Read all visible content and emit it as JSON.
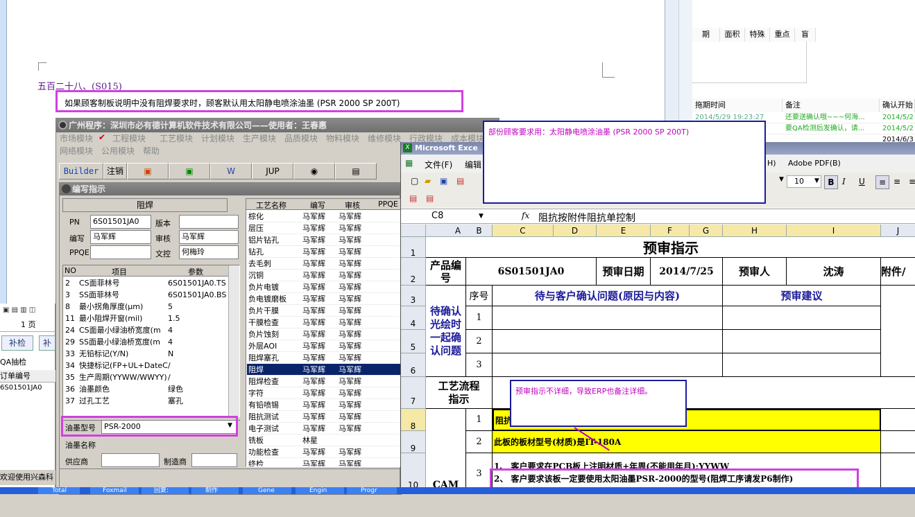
{
  "word": {
    "heading": "五百二十八、(S015)",
    "paragraph": "如果顾客制板说明中没有阻焊要求时，顾客默认用太阳静电喷涂油墨 (PSR 2000 SP 200T)",
    "page_label": "1 页"
  },
  "right_panel": {
    "top_headers": [
      "期",
      "面积",
      "特殊",
      "重点",
      "盲"
    ],
    "headers": [
      "拖期时间",
      "备注",
      "确认开始"
    ],
    "rows": [
      {
        "time": "2014/5/29 19:23:27",
        "note": "还要送确认哦~~~何海...",
        "start": "2014/5/2"
      },
      {
        "time": "",
        "note": "要QA检测后发确认，请...",
        "start": "2014/5/2"
      },
      {
        "time": "",
        "note": "",
        "start": "2014/6/3"
      }
    ]
  },
  "left_strip": {
    "button1": "补检",
    "button2": "补",
    "label": "QA抽检",
    "col_header": "订单编号",
    "row_value": "6S01501JA0",
    "welcome": "欢迎使用兴森科"
  },
  "main_window": {
    "title": "广州程序：深圳市必有德计算机软件技术有限公司——使用者：王春惠",
    "menu_row1": [
      "市场模块",
      "工程模块",
      "工艺模块",
      "计划模块",
      "生产模块",
      "品质模块",
      "物料模块",
      "维修模块",
      "行政模块",
      "成本模块"
    ],
    "menu_row2": [
      "网络模块",
      "公用模块",
      "帮助"
    ],
    "toolbar": [
      "Builder",
      "注销",
      "",
      "",
      "",
      "JUP",
      "",
      ""
    ],
    "sub_title": "编写指示",
    "section": "阻焊",
    "pn_label": "PN",
    "pn_value": "6S01501JA0",
    "version_label": "版本",
    "author_label": "编写",
    "author_value": "马军辉",
    "review_label": "审核",
    "review_value": "马军辉",
    "ppqe_label": "PPQE",
    "doc_label": "文控",
    "doc_value": "何梅玲",
    "param_headers": [
      "NO",
      "项目",
      "参数"
    ],
    "params": [
      {
        "no": "2",
        "item": "CS面菲林号",
        "val": "6S01501JA0.TS"
      },
      {
        "no": "3",
        "item": "SS面菲林号",
        "val": "6S01501JA0.BS"
      },
      {
        "no": "8",
        "item": "最小拐角厚度(μm)",
        "val": "5"
      },
      {
        "no": "11",
        "item": "最小阻焊开窗(mil)",
        "val": "1.5"
      },
      {
        "no": "24",
        "item": "CS面最小绿油桥宽度(m",
        "val": "4"
      },
      {
        "no": "29",
        "item": "SS面最小绿油桥宽度(m",
        "val": "4"
      },
      {
        "no": "33",
        "item": "无铅标记(Y/N)",
        "val": "N"
      },
      {
        "no": "34",
        "item": "快捷标记(FP+UL+DateCo",
        "val": "/"
      },
      {
        "no": "35",
        "item": "生产周期(YYWW/WWYY)",
        "val": "/"
      },
      {
        "no": "36",
        "item": "油墨颜色",
        "val": "绿色"
      },
      {
        "no": "37",
        "item": "过孔工艺",
        "val": "塞孔"
      }
    ],
    "ink_type_label": "油墨型号",
    "ink_type_value": "PSR-2000",
    "ink_name_label": "油墨名称",
    "supplier_label": "供应商",
    "maker_label": "制造商",
    "proc_headers": [
      "工艺名称",
      "编写",
      "审核",
      "PPQE"
    ],
    "procs": [
      {
        "n": "棕化",
        "a": "马军辉",
        "b": "马军辉"
      },
      {
        "n": "层压",
        "a": "马军辉",
        "b": "马军辉"
      },
      {
        "n": "铝片钻孔",
        "a": "马军辉",
        "b": "马军辉"
      },
      {
        "n": "钻孔",
        "a": "马军辉",
        "b": "马军辉"
      },
      {
        "n": "去毛刺",
        "a": "马军辉",
        "b": "马军辉"
      },
      {
        "n": "沉铜",
        "a": "马军辉",
        "b": "马军辉"
      },
      {
        "n": "负片电镀",
        "a": "马军辉",
        "b": "马军辉"
      },
      {
        "n": "负电镀磨板",
        "a": "马军辉",
        "b": "马军辉"
      },
      {
        "n": "负片干膜",
        "a": "马军辉",
        "b": "马军辉"
      },
      {
        "n": "干膜检查",
        "a": "马军辉",
        "b": "马军辉"
      },
      {
        "n": "负片蚀刻",
        "a": "马军辉",
        "b": "马军辉"
      },
      {
        "n": "外层AOI",
        "a": "马军辉",
        "b": "马军辉"
      },
      {
        "n": "阻焊塞孔",
        "a": "马军辉",
        "b": "马军辉"
      },
      {
        "n": "阻焊",
        "a": "马军辉",
        "b": "马军辉"
      },
      {
        "n": "阻焊检查",
        "a": "马军辉",
        "b": "马军辉"
      },
      {
        "n": "字符",
        "a": "马军辉",
        "b": "马军辉"
      },
      {
        "n": "有铅喷锡",
        "a": "马军辉",
        "b": "马军辉"
      },
      {
        "n": "阻抗测试",
        "a": "马军辉",
        "b": "马军辉"
      },
      {
        "n": "电子测试",
        "a": "马军辉",
        "b": "马军辉"
      },
      {
        "n": "铣板",
        "a": "林星",
        "b": ""
      },
      {
        "n": "功能检查",
        "a": "马军辉",
        "b": "马军辉"
      },
      {
        "n": "终检",
        "a": "马军辉",
        "b": "马军辉"
      }
    ]
  },
  "excel": {
    "title": "Microsoft Exce",
    "menu": [
      "文件(F)",
      "编辑"
    ],
    "menu_right": [
      "H)",
      "Adobe PDF(B)"
    ],
    "font_size": "10",
    "cell_ref": "C8",
    "formula": "阻抗按附件阻抗单控制",
    "columns": [
      "A",
      "B",
      "C",
      "D",
      "E",
      "F",
      "G",
      "H",
      "I",
      "J"
    ],
    "rows": [
      "1",
      "2",
      "3",
      "4",
      "5",
      "6",
      "7",
      "8",
      "9",
      "10"
    ],
    "sheet_title": "预审指示",
    "product_no_label": "产品编号",
    "product_no": "6S01501JA0",
    "date_label": "预审日期",
    "date": "2014/7/25",
    "reviewer_label": "预审人",
    "reviewer": "沈涛",
    "attach_label": "附件/",
    "seq_label": "序号",
    "issue_header": "待与客户确认问题(原因与内容)",
    "advice_header": "预审建议",
    "confirm_label": "待确认光绘时一起确认问题",
    "seq": [
      "1",
      "2",
      "3"
    ],
    "process_label": "工艺流程指示",
    "cam_label": "CAM",
    "r8_no": "1",
    "r8_text": "阻抗",
    "r9_no": "2",
    "r9_text": "此板的板材型号(材质)是IT-180A",
    "r10_no": "3",
    "r10_line1": "1、 客户要求在PCB板上注明材质+年周(不能用年月);YYWW",
    "r10_line2": "2、 客户要求该板一定要使用太阳油墨PSR-2000的型号(阻焊工序请发P6制作)"
  },
  "callouts": {
    "top": "部份顾客要求用：太阳静电喷涂油墨 (PSR 2000 SP 200T)",
    "mid": "预审指示不详细，导致ERP也备注详细。"
  },
  "taskbar": [
    "Total",
    "Foxmail",
    "回复:",
    "制作",
    "Gene",
    "Engin",
    "Progr"
  ],
  "colors": {
    "accent": "#d040e0",
    "callout_border": "#1a1aa0",
    "highlight": "#ffff00"
  }
}
